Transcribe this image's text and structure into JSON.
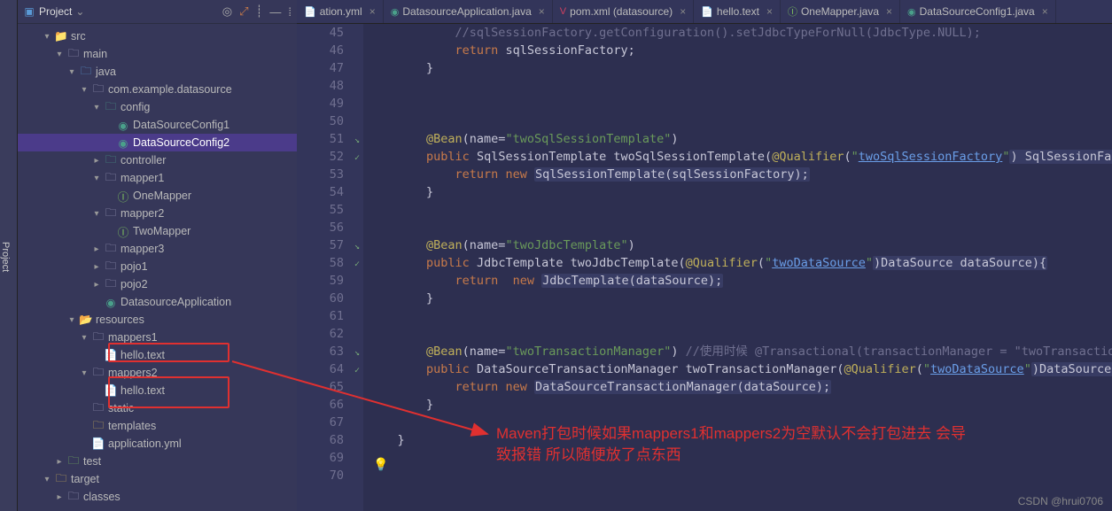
{
  "sideTool": "Project",
  "sidebar": {
    "title": "Project",
    "nodes": [
      {
        "indent": 2,
        "arrow": "▾",
        "icon": "📁",
        "iconClass": "blue",
        "label": "src"
      },
      {
        "indent": 3,
        "arrow": "▾",
        "icon": "🗀",
        "iconClass": "folder",
        "label": "main"
      },
      {
        "indent": 4,
        "arrow": "▾",
        "icon": "🗀",
        "iconClass": "blue",
        "label": "java"
      },
      {
        "indent": 5,
        "arrow": "▾",
        "icon": "🗀",
        "iconClass": "folder",
        "label": "com.example.datasource"
      },
      {
        "indent": 6,
        "arrow": "▾",
        "icon": "🗀",
        "iconClass": "teal",
        "label": "config"
      },
      {
        "indent": 7,
        "arrow": "",
        "icon": "◉",
        "iconClass": "teal",
        "label": "DataSourceConfig1"
      },
      {
        "indent": 7,
        "arrow": "",
        "icon": "◉",
        "iconClass": "teal",
        "label": "DataSourceConfig2",
        "sel": true
      },
      {
        "indent": 6,
        "arrow": "▸",
        "icon": "🗀",
        "iconClass": "teal",
        "label": "controller"
      },
      {
        "indent": 6,
        "arrow": "▾",
        "icon": "🗀",
        "iconClass": "folder",
        "label": "mapper1"
      },
      {
        "indent": 7,
        "arrow": "",
        "icon": "Ⓘ",
        "iconClass": "green",
        "label": "OneMapper"
      },
      {
        "indent": 6,
        "arrow": "▾",
        "icon": "🗀",
        "iconClass": "folder",
        "label": "mapper2"
      },
      {
        "indent": 7,
        "arrow": "",
        "icon": "Ⓘ",
        "iconClass": "green",
        "label": "TwoMapper"
      },
      {
        "indent": 6,
        "arrow": "▸",
        "icon": "🗀",
        "iconClass": "folder",
        "label": "mapper3"
      },
      {
        "indent": 6,
        "arrow": "▸",
        "icon": "🗀",
        "iconClass": "folder",
        "label": "pojo1"
      },
      {
        "indent": 6,
        "arrow": "▸",
        "icon": "🗀",
        "iconClass": "folder",
        "label": "pojo2"
      },
      {
        "indent": 6,
        "arrow": "",
        "icon": "◉",
        "iconClass": "teal",
        "label": "DatasourceApplication"
      },
      {
        "indent": 4,
        "arrow": "▾",
        "icon": "📂",
        "iconClass": "yellow",
        "label": "resources"
      },
      {
        "indent": 5,
        "arrow": "▾",
        "icon": "🗀",
        "iconClass": "folder",
        "label": "mappers1"
      },
      {
        "indent": 6,
        "arrow": "",
        "icon": "📄",
        "iconClass": "",
        "label": "hello.text"
      },
      {
        "indent": 5,
        "arrow": "▾",
        "icon": "🗀",
        "iconClass": "folder",
        "label": "mappers2"
      },
      {
        "indent": 6,
        "arrow": "",
        "icon": "📄",
        "iconClass": "",
        "label": "hello.text"
      },
      {
        "indent": 5,
        "arrow": "",
        "icon": "🗀",
        "iconClass": "folder",
        "label": "static"
      },
      {
        "indent": 5,
        "arrow": "",
        "icon": "🗀",
        "iconClass": "yellow",
        "label": "templates"
      },
      {
        "indent": 5,
        "arrow": "",
        "icon": "📄",
        "iconClass": "yellow",
        "label": "application.yml"
      },
      {
        "indent": 3,
        "arrow": "▸",
        "icon": "🗀",
        "iconClass": "green",
        "label": "test"
      },
      {
        "indent": 2,
        "arrow": "▾",
        "icon": "🗀",
        "iconClass": "yellow",
        "label": "target"
      },
      {
        "indent": 3,
        "arrow": "▸",
        "icon": "🗀",
        "iconClass": "folder",
        "label": "classes"
      }
    ]
  },
  "tabs": [
    {
      "icon": "📄",
      "iconColor": "#d1b35a",
      "label": "ation.yml",
      "close": "×"
    },
    {
      "icon": "◉",
      "iconColor": "#4aa08a",
      "label": "DatasourceApplication.java",
      "close": "×"
    },
    {
      "icon": "V",
      "iconColor": "#d04060",
      "label": "pom.xml (datasource)",
      "close": "×"
    },
    {
      "icon": "📄",
      "iconColor": "#bbb",
      "label": "hello.text",
      "close": "×"
    },
    {
      "icon": "Ⓘ",
      "iconColor": "#7bbf5e",
      "label": "OneMapper.java",
      "close": "×"
    },
    {
      "icon": "◉",
      "iconColor": "#4aa08a",
      "label": "DataSourceConfig1.java",
      "close": "×"
    }
  ],
  "gutter": {
    "start": 45,
    "marks": {
      "51": "↘",
      "52": "✓",
      "57": "↘",
      "58": "✓",
      "63": "↘",
      "64": "✓"
    }
  },
  "code": [
    {
      "t": "            //sqlSessionFactory.getConfiguration().setJdbcTypeForNull(JdbcType.NULL);",
      "cls": "cmt"
    },
    {
      "segs": [
        {
          "t": "            "
        },
        {
          "t": "return ",
          "c": "kw"
        },
        {
          "t": "sqlSessionFactory;"
        }
      ]
    },
    {
      "t": "        }"
    },
    {
      "t": ""
    },
    {
      "t": ""
    },
    {
      "t": ""
    },
    {
      "segs": [
        {
          "t": "        "
        },
        {
          "t": "@Bean",
          "c": "ann"
        },
        {
          "t": "(name="
        },
        {
          "t": "\"twoSqlSessionTemplate\"",
          "c": "str"
        },
        {
          "t": ")"
        }
      ]
    },
    {
      "segs": [
        {
          "t": "        "
        },
        {
          "t": "public ",
          "c": "kw"
        },
        {
          "t": "SqlSessionTemplate twoSqlSessionTemplate("
        },
        {
          "t": "@Qualifier",
          "c": "ann"
        },
        {
          "t": "("
        },
        {
          "t": "\"",
          "c": "str"
        },
        {
          "t": "twoSqlSessionFactory",
          "c": "lnk"
        },
        {
          "t": "\"",
          "c": "str"
        },
        {
          "t": ") SqlSessionFactory s",
          "hl": true
        }
      ]
    },
    {
      "segs": [
        {
          "t": "            "
        },
        {
          "t": "return new ",
          "c": "kw"
        },
        {
          "t": "SqlSessionTemplate(sqlSessionFactory);",
          "hl": true
        }
      ]
    },
    {
      "t": "        }"
    },
    {
      "t": ""
    },
    {
      "t": ""
    },
    {
      "segs": [
        {
          "t": "        "
        },
        {
          "t": "@Bean",
          "c": "ann"
        },
        {
          "t": "(name="
        },
        {
          "t": "\"twoJdbcTemplate\"",
          "c": "str"
        },
        {
          "t": ")"
        }
      ]
    },
    {
      "segs": [
        {
          "t": "        "
        },
        {
          "t": "public ",
          "c": "kw"
        },
        {
          "t": "JdbcTemplate twoJdbcTemplate("
        },
        {
          "t": "@Qualifier",
          "c": "ann"
        },
        {
          "t": "("
        },
        {
          "t": "\"",
          "c": "str"
        },
        {
          "t": "twoDataSource",
          "c": "lnk"
        },
        {
          "t": "\"",
          "c": "str"
        },
        {
          "t": ")DataSource dataSource){",
          "hl": true
        }
      ]
    },
    {
      "segs": [
        {
          "t": "            "
        },
        {
          "t": "return  new ",
          "c": "kw"
        },
        {
          "t": "JdbcTemplate(dataSource);",
          "hl": true
        }
      ]
    },
    {
      "t": "        }"
    },
    {
      "t": ""
    },
    {
      "t": ""
    },
    {
      "segs": [
        {
          "t": "        "
        },
        {
          "t": "@Bean",
          "c": "ann"
        },
        {
          "t": "(name="
        },
        {
          "t": "\"twoTransactionManager\"",
          "c": "str"
        },
        {
          "t": ") "
        },
        {
          "t": "//使用时候 @Transactional(transactionManager = \"twoTransactionManag",
          "c": "cmt"
        }
      ]
    },
    {
      "segs": [
        {
          "t": "        "
        },
        {
          "t": "public ",
          "c": "kw"
        },
        {
          "t": "DataSourceTransactionManager twoTransactionManager("
        },
        {
          "t": "@Qualifier",
          "c": "ann"
        },
        {
          "t": "("
        },
        {
          "t": "\"",
          "c": "str"
        },
        {
          "t": "twoDataSource",
          "c": "lnk"
        },
        {
          "t": "\"",
          "c": "str"
        },
        {
          "t": ")DataSource dataSo",
          "hl": true
        }
      ]
    },
    {
      "segs": [
        {
          "t": "            "
        },
        {
          "t": "return new ",
          "c": "kw"
        },
        {
          "t": "DataSourceTransactionManager(dataSource);",
          "hl": true
        }
      ]
    },
    {
      "t": "        }"
    },
    {
      "t": ""
    },
    {
      "t": "    }"
    },
    {
      "t": ""
    },
    {
      "t": ""
    }
  ],
  "annotation": {
    "line1": "Maven打包时候如果mappers1和mappers2为空默认不会打包进去  会导",
    "line2": "致报错  所以随便放了点东西"
  },
  "watermark": "CSDN @hrui0706"
}
